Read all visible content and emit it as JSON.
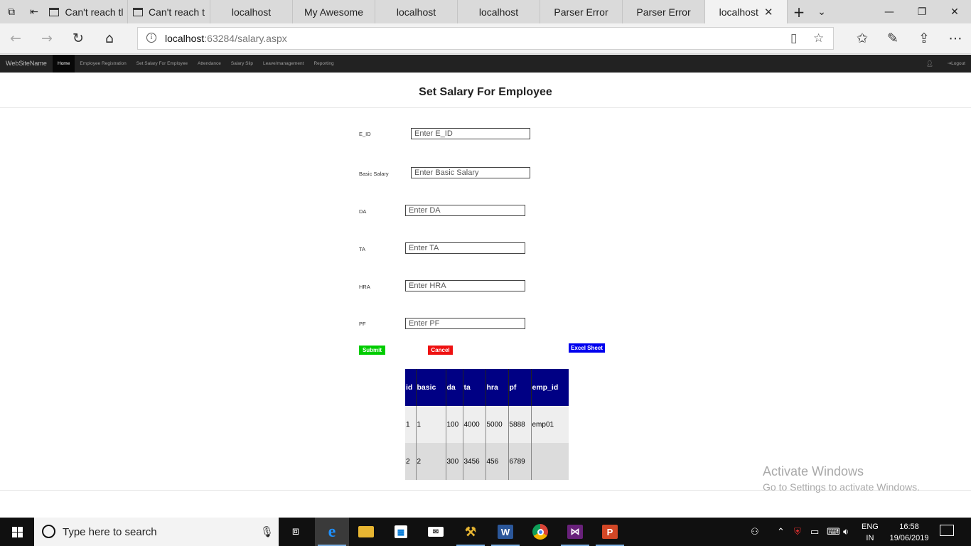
{
  "browser": {
    "tabs": [
      {
        "label": "Can't reach tl",
        "icon": "page-icon"
      },
      {
        "label": "Can't reach t",
        "icon": "page-icon"
      },
      {
        "label": "localhost"
      },
      {
        "label": "My Awesome"
      },
      {
        "label": "localhost"
      },
      {
        "label": "localhost"
      },
      {
        "label": "Parser Error"
      },
      {
        "label": "Parser Error"
      },
      {
        "label": "localhost",
        "active": true
      }
    ],
    "address": {
      "host": "localhost",
      "rest": ":63284/salary.aspx"
    }
  },
  "site": {
    "brand": "WebSiteName",
    "nav": [
      "Home",
      "Employee Registration",
      "Set Salary For Employee",
      "Attendance",
      "Salary Slip",
      "Leave/management",
      "Reporting"
    ],
    "logout": "Logout"
  },
  "page": {
    "title": "Set Salary For Employee",
    "fields": {
      "eid": {
        "label": "E_ID",
        "placeholder": "Enter E_ID",
        "value": ""
      },
      "basic": {
        "label": "Basic Salary",
        "placeholder": "Enter Basic Salary",
        "value": ""
      },
      "da": {
        "label": "DA",
        "placeholder": "Enter DA",
        "value": ""
      },
      "ta": {
        "label": "TA",
        "placeholder": "Enter TA",
        "value": ""
      },
      "hra": {
        "label": "HRA",
        "placeholder": "Enter HRA",
        "value": ""
      },
      "pf": {
        "label": "PF",
        "placeholder": "Enter PF",
        "value": ""
      }
    },
    "buttons": {
      "submit": {
        "label": "Submit",
        "color": "#00cc00"
      },
      "cancel": {
        "label": "Cancel",
        "color": "#ee1111"
      },
      "excel": {
        "label": "Excel Sheet",
        "color": "#0000ee"
      }
    },
    "grid": {
      "columns": [
        "id",
        "basic",
        "da",
        "ta",
        "hra",
        "pf",
        "emp_id"
      ],
      "rows": [
        [
          "1",
          "1",
          "100",
          "4000",
          "5000",
          "5888",
          "emp01"
        ],
        [
          "2",
          "2",
          "300",
          "3456",
          "456",
          "6789",
          ""
        ]
      ],
      "header_color": "#000084"
    }
  },
  "watermark": {
    "line1": "Activate Windows",
    "line2": "Go to Settings to activate Windows."
  },
  "taskbar": {
    "search_placeholder": "Type here to search",
    "lang1": "ENG",
    "lang2": "IN",
    "time": "16:58",
    "date": "19/06/2019"
  }
}
